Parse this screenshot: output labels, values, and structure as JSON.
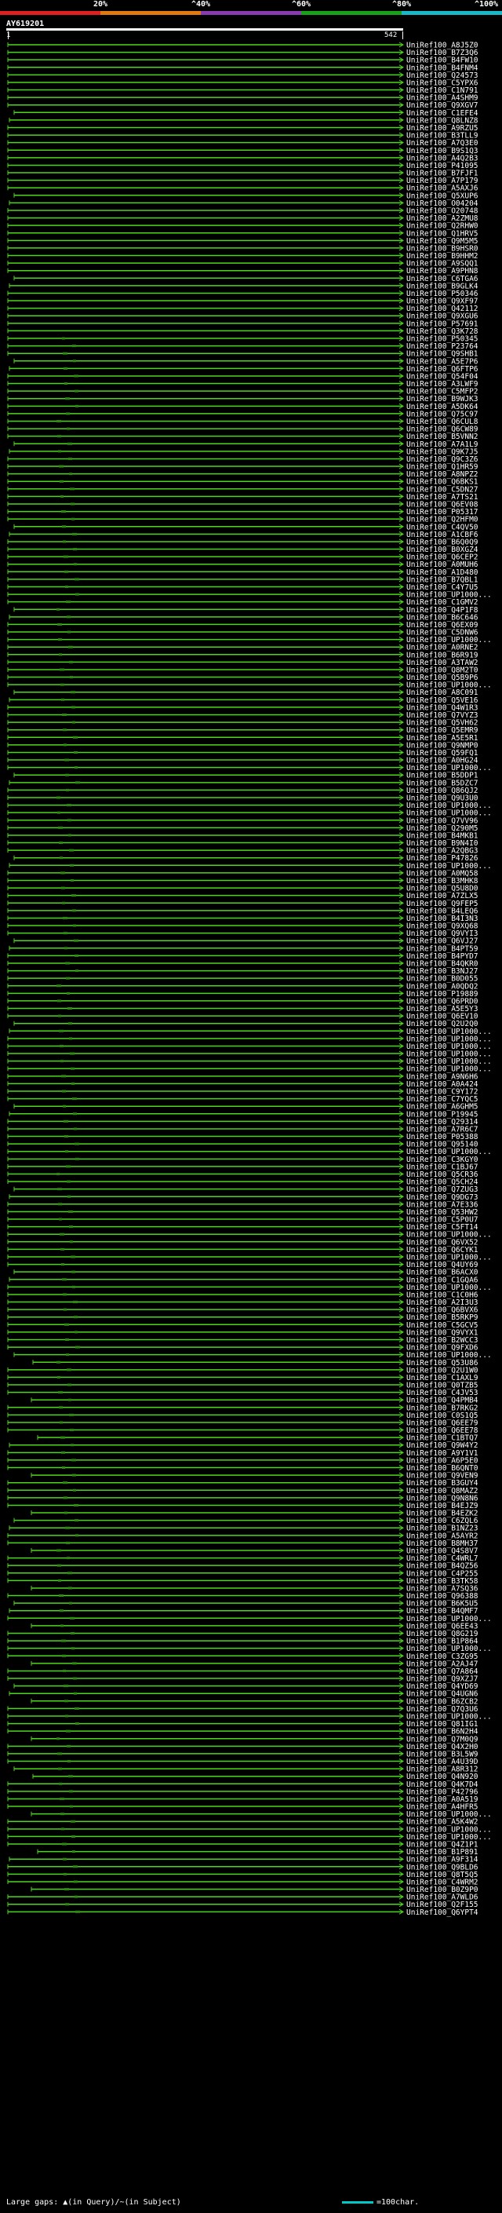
{
  "header": {
    "query_id": "AY619201",
    "q_start": "1",
    "q_end": "542",
    "scale": [
      {
        "label": "20%",
        "color": "#e02020",
        "from": 0.0,
        "to": 0.2
      },
      {
        "label": "^40%",
        "color": "#e07a10",
        "from": 0.2,
        "to": 0.4
      },
      {
        "label": "^60%",
        "color": "#8a3ab0",
        "from": 0.4,
        "to": 0.6
      },
      {
        "label": "^80%",
        "color": "#18a018",
        "from": 0.6,
        "to": 0.8
      },
      {
        "label": "^100%",
        "color": "#18b8c8",
        "from": 0.8,
        "to": 1.0
      }
    ]
  },
  "colors": {
    "hit": "#4cd61a",
    "hit_dark": "#2c8a10",
    "query": "#ffffff",
    "unit": "#00c8c8"
  },
  "hits": [
    "UniRef100_A8J5Z0",
    "UniRef100_B7Z3Q6",
    "UniRef100_B4FW10",
    "UniRef100_B4FNM4",
    "UniRef100_Q24573",
    "UniRef100_C5YPX6",
    "UniRef100_C1N791",
    "UniRef100_A4SHM9",
    "UniRef100_Q9XGV7",
    "UniRef100_C1EFE4",
    "UniRef100_Q8LNZ8",
    "UniRef100_A9RZU5",
    "UniRef100_B3TLL9",
    "UniRef100_A7Q3E0",
    "UniRef100_B9S1Q3",
    "UniRef100_A4Q2B3",
    "UniRef100_P41095",
    "UniRef100_B7FJF1",
    "UniRef100_A7P179",
    "UniRef100_A5AXJ6",
    "UniRef100_Q5XUP6",
    "UniRef100_O04204",
    "UniRef100_O20748",
    "UniRef100_A2ZMU8",
    "UniRef100_Q2RHW0",
    "UniRef100_Q1HRV5",
    "UniRef100_Q9M5M5",
    "UniRef100_B9HSR0",
    "UniRef100_B9HHM2",
    "UniRef100_A9SQQ1",
    "UniRef100_A9PHN8",
    "UniRef100_C6TGA6",
    "UniRef100_B9GLK4",
    "UniRef100_P50346",
    "UniRef100_Q9XF97",
    "UniRef100_Q42112",
    "UniRef100_Q9XGU6",
    "UniRef100_P57691",
    "UniRef100_Q3K728",
    "UniRef100_P50345",
    "UniRef100_P23764",
    "UniRef100_Q9SHB1",
    "UniRef100_A5E7P6",
    "UniRef100_Q6FTP6",
    "UniRef100_Q54F04",
    "UniRef100_A3LWF9",
    "UniRef100_C5MFP2",
    "UniRef100_B9WJK3",
    "UniRef100_A5DK64",
    "UniRef100_Q75C97",
    "UniRef100_Q6CUL8",
    "UniRef100_Q6CW89",
    "UniRef100_B5VNN2",
    "UniRef100_A7A1L9",
    "UniRef100_Q9K7J5",
    "UniRef100_Q9C3Z6",
    "UniRef100_Q1HR59",
    "UniRef100_A8NPZ2",
    "UniRef100_Q6BKS1",
    "UniRef100_C5DN27",
    "UniRef100_A7TS21",
    "UniRef100_Q6EV08",
    "UniRef100_P05317",
    "UniRef100_Q2HFM0",
    "UniRef100_C4QV50",
    "UniRef100_A1CBF6",
    "UniRef100_B6Q0Q9",
    "UniRef100_B0XGZ4",
    "UniRef100_Q6CEP2",
    "UniRef100_A0MUH6",
    "UniRef100_A1D480",
    "UniRef100_B7QBL1",
    "UniRef100_C4Y7U5",
    "UniRef100_UP1000...",
    "UniRef100_C1GMV2",
    "UniRef100_Q4P1F8",
    "UniRef100_B6C646",
    "UniRef100_Q6EX09",
    "UniRef100_C5DNW6",
    "UniRef100_UP1000...",
    "UniRef100_A0RNE2",
    "UniRef100_B6R919",
    "UniRef100_A3TAW2",
    "UniRef100_Q8M2T0",
    "UniRef100_Q5B9P6",
    "UniRef100_UP1000...",
    "UniRef100_A8C091",
    "UniRef100_Q5VE16",
    "UniRef100_Q4W1R3",
    "UniRef100_Q7VYZ3",
    "UniRef100_Q5VH62",
    "UniRef100_Q5EMR9",
    "UniRef100_A5E5R1",
    "UniRef100_Q9NMP0",
    "UniRef100_Q59FQ1",
    "UniRef100_A0HG24",
    "UniRef100_UP1000...",
    "UniRef100_B5DDP1",
    "UniRef100_B5DZC7",
    "UniRef100_Q86QJ2",
    "UniRef100_Q9U3U0",
    "UniRef100_UP1000...",
    "UniRef100_UP1000...",
    "UniRef100_Q7VV96",
    "UniRef100_Q290M5",
    "UniRef100_B4MKB1",
    "UniRef100_B9N4I0",
    "UniRef100_A2QBG3",
    "UniRef100_P47826",
    "UniRef100_UP1000...",
    "UniRef100_A0MQ58",
    "UniRef100_B3MHK8",
    "UniRef100_Q5U8D0",
    "UniRef100_A7ZLX5",
    "UniRef100_Q9FEP5",
    "UniRef100_B4LEQ6",
    "UniRef100_B4I3N3",
    "UniRef100_Q9XQ68",
    "UniRef100_Q9VYI3",
    "UniRef100_Q6VJ27",
    "UniRef100_B4PT59",
    "UniRef100_B4PYD7",
    "UniRef100_B4QKR0",
    "UniRef100_B3NJ27",
    "UniRef100_B0D055",
    "UniRef100_A0QDQ2",
    "UniRef100_P19889",
    "UniRef100_Q6PRD0",
    "UniRef100_A5E5Y3",
    "UniRef100_Q6EV10",
    "UniRef100_Q2U2Q0",
    "UniRef100_UP1000...",
    "UniRef100_UP1000...",
    "UniRef100_UP1000...",
    "UniRef100_UP1000...",
    "UniRef100_UP1000...",
    "UniRef100_UP1000...",
    "UniRef100_A9N6H6",
    "UniRef100_A0A424",
    "UniRef100_C9Y172",
    "UniRef100_C7YQC5",
    "UniRef100_A6GHM5",
    "UniRef100_P19945",
    "UniRef100_Q29314",
    "UniRef100_A7R6C7",
    "UniRef100_P05388",
    "UniRef100_Q95140",
    "UniRef100_UP1000...",
    "UniRef100_C3KGY0",
    "UniRef100_C1BJ67",
    "UniRef100_Q5CR36",
    "UniRef100_Q5CH24",
    "UniRef100_Q7ZUG3",
    "UniRef100_Q9DG73",
    "UniRef100_A7E336",
    "UniRef100_Q53HW2",
    "UniRef100_C5P0U7",
    "UniRef100_C5FT14",
    "UniRef100_UP1000...",
    "UniRef100_Q6VX52",
    "UniRef100_Q6CYK1",
    "UniRef100_UP1000...",
    "UniRef100_Q4UY69",
    "UniRef100_B6ACX0",
    "UniRef100_C1GQA6",
    "UniRef100_UP1000...",
    "UniRef100_C1C0H6",
    "UniRef100_A2I3U3",
    "UniRef100_Q6BVX6",
    "UniRef100_B5RKP9",
    "UniRef100_C5GCV5",
    "UniRef100_Q9VYX1",
    "UniRef100_B2WCC3",
    "UniRef100_Q9FXD6",
    "UniRef100_UP1000...",
    "UniRef100_Q53U86",
    "UniRef100_Q2U1W0",
    "UniRef100_C1AXL9",
    "UniRef100_Q0TZB5",
    "UniRef100_C4JV53",
    "UniRef100_Q4PMB4",
    "UniRef100_B7RKG2",
    "UniRef100_C0S1Q5",
    "UniRef100_Q6EE79",
    "UniRef100_Q6EE78",
    "UniRef100_C1BTQ7",
    "UniRef100_Q9W4Y2",
    "UniRef100_A9Y1V1",
    "UniRef100_A6P5E0",
    "UniRef100_B6QNT0",
    "UniRef100_Q9VEN9",
    "UniRef100_B3GUY4",
    "UniRef100_Q8MAZ2",
    "UniRef100_Q9N8N6",
    "UniRef100_B4EJZ9",
    "UniRef100_B4EZK2",
    "UniRef100_C6ZQL6",
    "UniRef100_B1NZ23",
    "UniRef100_A5AYR2",
    "UniRef100_B8MH37",
    "UniRef100_Q4S8V7",
    "UniRef100_C4WRL7",
    "UniRef100_B4QZ56",
    "UniRef100_C4P255",
    "UniRef100_B3TK58",
    "UniRef100_A7SQ36",
    "UniRef100_Q96388",
    "UniRef100_B6K5U5",
    "UniRef100_B4QMF7",
    "UniRef100_UP1000...",
    "UniRef100_Q6EE43",
    "UniRef100_Q8G219",
    "UniRef100_B1P864",
    "UniRef100_UP1000...",
    "UniRef100_C3ZG95",
    "UniRef100_A2AJ47",
    "UniRef100_Q7A864",
    "UniRef100_Q9XZJ7",
    "UniRef100_Q4YD69",
    "UniRef100_Q4UGN6",
    "UniRef100_B6ZCB2",
    "UniRef100_Q7Q3U6",
    "UniRef100_UP1000...",
    "UniRef100_Q81IG1",
    "UniRef100_B6N2H4",
    "UniRef100_Q7M0Q9",
    "UniRef100_Q4X2H0",
    "UniRef100_B3L5W9",
    "UniRef100_A4U39D",
    "UniRef100_A8R312",
    "UniRef100_Q4N920",
    "UniRef100_Q4K7D4",
    "UniRef100_P42796",
    "UniRef100_A0A519",
    "UniRef100_A4HFR5",
    "UniRef100_UP1000...",
    "UniRef100_A5K4W2",
    "UniRef100_UP1000...",
    "UniRef100_UP1000...",
    "UniRef100_Q4Z1P1",
    "UniRef100_B1P891",
    "UniRef100_A9F314",
    "UniRef100_Q9BLD6",
    "UniRef100_Q8T5Q5",
    "UniRef100_C4WRM2",
    "UniRef100_B0Z9P0",
    "UniRef100_A7WLD6",
    "UniRef100_Q2F155",
    "UniRef100_Q6YPT4"
  ],
  "footer": {
    "gap_text": "Large gaps: ▲(in Query)/~(in Subject)",
    "unit_text": "=100char."
  }
}
